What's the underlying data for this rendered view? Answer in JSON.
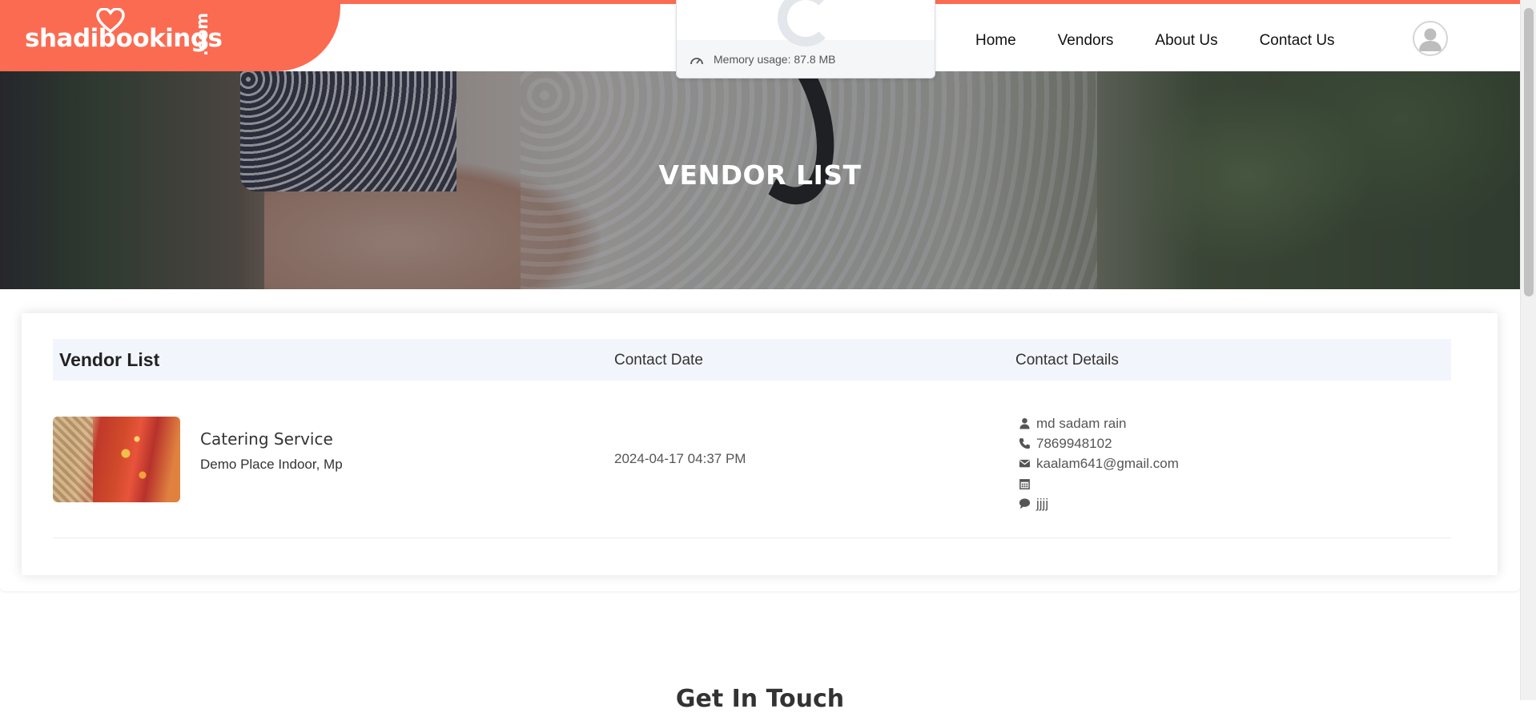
{
  "brand": {
    "logo_text": "shadibookings",
    "logo_suffix": ".com",
    "accent_color": "#fb6b52"
  },
  "nav": {
    "items": [
      {
        "label": "Home"
      },
      {
        "label": "Vendors"
      },
      {
        "label": "About Us"
      },
      {
        "label": "Contact Us"
      }
    ],
    "avatar_icon": "user-avatar-icon"
  },
  "overlay": {
    "memory_label": "Memory usage: 87.8 MB",
    "icon": "gauge-icon"
  },
  "hero": {
    "title": "VENDOR LIST"
  },
  "table": {
    "headers": {
      "vendor": "Vendor List",
      "date": "Contact Date",
      "details": "Contact Details"
    },
    "rows": [
      {
        "vendor_name": "Catering Service",
        "vendor_place": "Demo Place Indoor, Mp",
        "contact_date": "2024-04-17 04:37 PM",
        "contact_name": "md sadam rain",
        "phone": "7869948102",
        "email": "kaalam641@gmail.com",
        "event_date": "",
        "message": "jjjj"
      }
    ]
  },
  "footer": {
    "get_in_touch": "Get In Touch"
  }
}
